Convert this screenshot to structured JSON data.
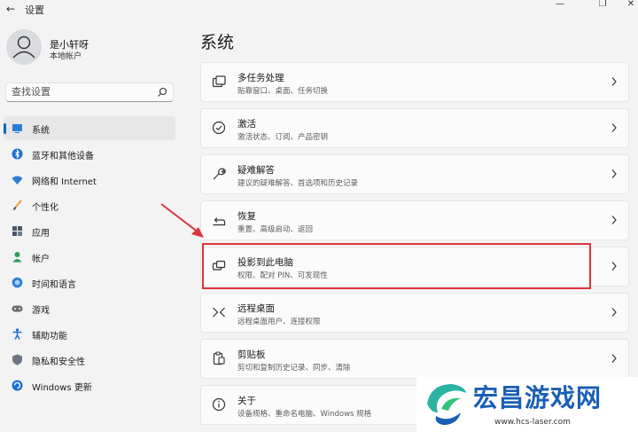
{
  "window": {
    "title": "设置",
    "back_icon": "back-arrow-icon",
    "controls": [
      "minimize-icon",
      "restore-icon",
      "close-icon"
    ]
  },
  "profile": {
    "name": "是小轩呀",
    "account_type": "本地帐户"
  },
  "search": {
    "placeholder": "查找设置"
  },
  "sidebar": {
    "accent_color": "#0067c0",
    "items": [
      {
        "label": "系统",
        "icon": "system-display-icon",
        "active": true
      },
      {
        "label": "蓝牙和其他设备",
        "icon": "bluetooth-icon",
        "active": false
      },
      {
        "label": "网络和 Internet",
        "icon": "wifi-icon",
        "active": false
      },
      {
        "label": "个性化",
        "icon": "brush-icon",
        "active": false
      },
      {
        "label": "应用",
        "icon": "apps-icon",
        "active": false
      },
      {
        "label": "帐户",
        "icon": "account-icon",
        "active": false
      },
      {
        "label": "时间和语言",
        "icon": "globe-clock-icon",
        "active": false
      },
      {
        "label": "游戏",
        "icon": "gamepad-icon",
        "active": false
      },
      {
        "label": "辅助功能",
        "icon": "accessibility-icon",
        "active": false
      },
      {
        "label": "隐私和安全性",
        "icon": "shield-icon",
        "active": false
      },
      {
        "label": "Windows 更新",
        "icon": "update-icon",
        "active": false
      }
    ]
  },
  "main": {
    "title": "系统",
    "cards": [
      {
        "title": "多任务处理",
        "subtitle": "贴靠窗口、桌面、任务切换",
        "icon": "multitasking-icon"
      },
      {
        "title": "激活",
        "subtitle": "激活状态、订阅、产品密钥",
        "icon": "activation-check-icon"
      },
      {
        "title": "疑难解答",
        "subtitle": "建议的疑难解答、首选项和历史记录",
        "icon": "wrench-icon"
      },
      {
        "title": "恢复",
        "subtitle": "重置、高级启动、返回",
        "icon": "recovery-icon"
      },
      {
        "title": "投影到此电脑",
        "subtitle": "权限、配对 PIN、可发现性",
        "icon": "project-to-pc-icon",
        "highlighted": true
      },
      {
        "title": "远程桌面",
        "subtitle": "远程桌面用户、连接权限",
        "icon": "remote-desktop-icon"
      },
      {
        "title": "剪贴板",
        "subtitle": "剪切和复制历史记录、同步、清除",
        "icon": "clipboard-icon"
      },
      {
        "title": "关于",
        "subtitle": "设备规格、重命名电脑、Windows 规格",
        "icon": "info-icon"
      }
    ]
  },
  "annotation": {
    "arrow_color": "#d9363e",
    "highlight_color": "#d9363e"
  },
  "watermark": {
    "brand": "宏昌游戏网",
    "url": "www.hcs-laser.com",
    "color": "#1a5fb4"
  }
}
